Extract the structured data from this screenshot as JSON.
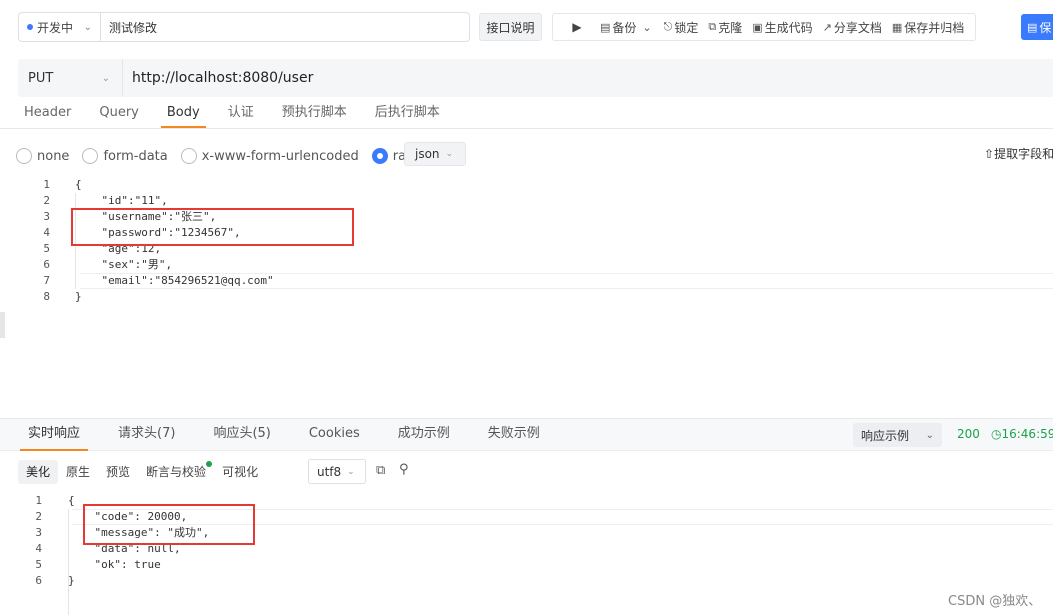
{
  "topbar": {
    "environment": "开发中",
    "api_name": "测试修改",
    "doc_button": "接口说明",
    "toolbar_items": [
      "备份",
      "锁定",
      "克隆",
      "生成代码",
      "分享文档",
      "保存并归档"
    ],
    "save_button": "保"
  },
  "request": {
    "method": "PUT",
    "url": "http://localhost:8080/user",
    "tabs": [
      "Header",
      "Query",
      "Body",
      "认证",
      "预执行脚本",
      "后执行脚本"
    ],
    "active_tab": "Body",
    "body_types": [
      "none",
      "form-data",
      "x-www-form-urlencoded",
      "raw"
    ],
    "selected_body_type": "raw",
    "format": "json",
    "extract_label": "提取字段和",
    "line_numbers": [
      "1",
      "2",
      "3",
      "4",
      "5",
      "6",
      "7",
      "8"
    ],
    "code_lines": [
      "{",
      "    \"id\":\"11\",",
      "    \"username\":\"张三\",",
      "    \"password\":\"1234567\",",
      "    \"age\":12,",
      "    \"sex\":\"男\",",
      "    \"email\":\"854296521@qq.com\"",
      "}"
    ]
  },
  "response": {
    "tabs": [
      "实时响应",
      "请求头(7)",
      "响应头(5)",
      "Cookies",
      "成功示例",
      "失败示例"
    ],
    "active_tab": "实时响应",
    "example_select": "响应示例",
    "status_code": "200",
    "time": "16:46:59",
    "view_tabs": [
      "美化",
      "原生",
      "预览",
      "断言与校验",
      "可视化"
    ],
    "active_view": "美化",
    "encoding": "utf8",
    "line_numbers": [
      "1",
      "2",
      "3",
      "4",
      "5",
      "6"
    ],
    "code_lines": [
      "{",
      "    \"code\": 20000,",
      "    \"message\": \"成功\",",
      "    \"data\": null,",
      "    \"ok\": true",
      "}"
    ]
  },
  "watermark": "CSDN @独欢、",
  "colors": {
    "accent": "#3a7afe",
    "tab_underline": "#f5871f",
    "success": "#1aa34a",
    "highlight_box": "#e53935"
  }
}
